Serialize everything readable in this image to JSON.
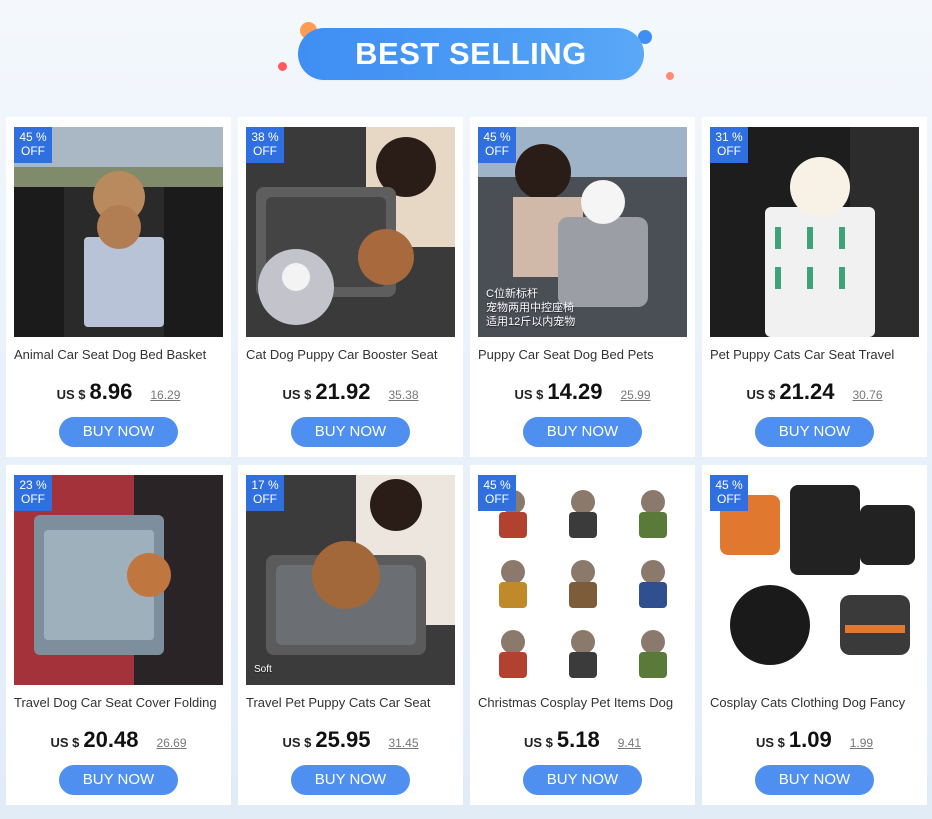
{
  "header": {
    "title": "BEST SELLING"
  },
  "products": [
    {
      "discount": "45 %",
      "off": "OFF",
      "title": "Animal Car Seat Dog Bed Basket",
      "currency": "US $",
      "price": "8.96",
      "old_price": "16.29",
      "cta": "BUY NOW",
      "image_caption": "",
      "image_theme": "car-window"
    },
    {
      "discount": "38 %",
      "off": "OFF",
      "title": "Cat Dog Puppy Car Booster Seat",
      "currency": "US $",
      "price": "21.92",
      "old_price": "35.38",
      "cta": "BUY NOW",
      "image_caption": "",
      "image_theme": "woman-car-console"
    },
    {
      "discount": "45 %",
      "off": "OFF",
      "title": "Puppy Car Seat Dog Bed Pets",
      "currency": "US $",
      "price": "14.29",
      "old_price": "25.99",
      "cta": "BUY NOW",
      "image_caption": "C位新标杆\n宠物两用中控座椅\n适用12斤以内宠物",
      "image_theme": "driver-console"
    },
    {
      "discount": "31 %",
      "off": "OFF",
      "title": "Pet Puppy Cats Car Seat Travel",
      "currency": "US $",
      "price": "21.24",
      "old_price": "30.76",
      "cta": "BUY NOW",
      "image_caption": "",
      "image_theme": "cactus-bag"
    },
    {
      "discount": "23 %",
      "off": "OFF",
      "title": "Travel Dog Car Seat Cover Folding",
      "currency": "US $",
      "price": "20.48",
      "old_price": "26.69",
      "cta": "BUY NOW",
      "image_caption": "",
      "image_theme": "red-seat"
    },
    {
      "discount": "17 %",
      "off": "OFF",
      "title": "Travel Pet Puppy Cats Car Seat",
      "currency": "US $",
      "price": "25.95",
      "old_price": "31.45",
      "cta": "BUY NOW",
      "image_caption": "Soft",
      "image_theme": "woman-console-2"
    },
    {
      "discount": "45 %",
      "off": "OFF",
      "title": "Christmas Cosplay Pet Items Dog",
      "currency": "US $",
      "price": "5.18",
      "old_price": "9.41",
      "cta": "BUY NOW",
      "image_caption": "",
      "image_theme": "costume-grid"
    },
    {
      "discount": "45 %",
      "off": "OFF",
      "title": "Cosplay Cats Clothing Dog Fancy",
      "currency": "US $",
      "price": "1.09",
      "old_price": "1.99",
      "cta": "BUY NOW",
      "image_caption": "",
      "image_theme": "halloween"
    }
  ],
  "colors": {
    "accent": "#4e8ff0",
    "badge": "#2f6fe0",
    "banner": "#3f8ef3"
  }
}
